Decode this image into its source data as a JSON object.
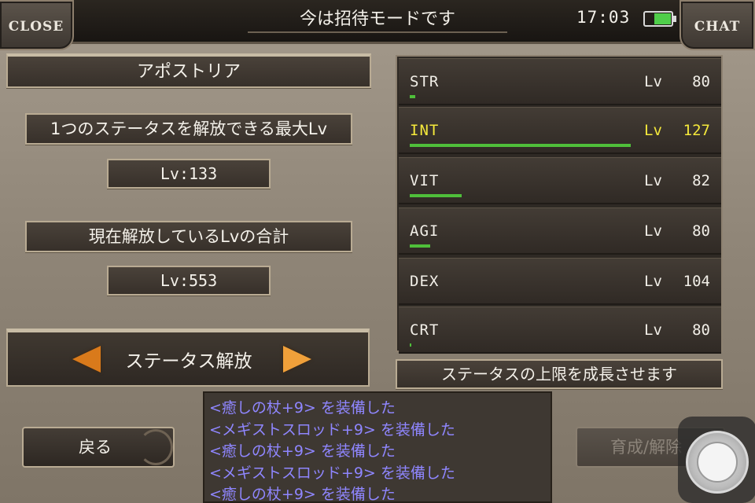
{
  "header": {
    "close_label": "CLOSE",
    "title": "今は招待モードです",
    "time": "17:03",
    "chat_label": "CHAT"
  },
  "left": {
    "character_name": "アポストリア",
    "max_lv_label": "1つのステータスを解放できる最大Lv",
    "max_lv_value": "Lv:133",
    "total_lv_label": "現在解放しているLvの合計",
    "total_lv_value": "Lv:553",
    "release_label": "ステータス解放"
  },
  "stats": [
    {
      "name": "STR",
      "lv": "Lv",
      "value": "80",
      "bar": 0.02,
      "highlight": false
    },
    {
      "name": "INT",
      "lv": "Lv",
      "value": "127",
      "bar": 0.85,
      "highlight": true
    },
    {
      "name": "VIT",
      "lv": "Lv",
      "value": "82",
      "bar": 0.2,
      "highlight": false
    },
    {
      "name": "AGI",
      "lv": "Lv",
      "value": "80",
      "bar": 0.08,
      "highlight": false
    },
    {
      "name": "DEX",
      "lv": "Lv",
      "value": "104",
      "bar": 0.0,
      "highlight": false
    },
    {
      "name": "CRT",
      "lv": "Lv",
      "value": "80",
      "bar": 0.005,
      "highlight": false
    }
  ],
  "stat_description": "ステータスの上限を成長させます",
  "log": [
    "<癒しの杖+9> を装備した",
    "<メギストスロッド+9> を装備した",
    "<癒しの杖+9> を装備した",
    "<メギストスロッド+9> を装備した",
    "<癒しの杖+9> を装備した"
  ],
  "buttons": {
    "back": "戻る",
    "train": "育成/解除"
  },
  "colors": {
    "highlight": "#f5e93b",
    "bar": "#4fbf3a",
    "log_text": "#8f86ff",
    "release_arrow": "#d97a1b"
  }
}
